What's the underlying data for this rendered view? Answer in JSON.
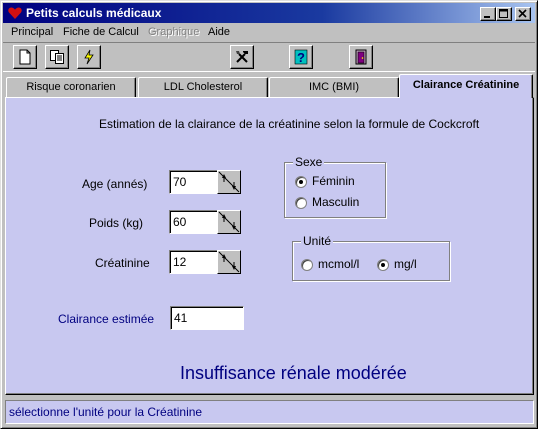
{
  "window": {
    "title": "Petits calculs médicaux"
  },
  "menu": [
    {
      "label": "Principal",
      "disabled": false
    },
    {
      "label": "Fiche de Calcul",
      "disabled": false
    },
    {
      "label": "Graphique",
      "disabled": true
    },
    {
      "label": "Aide",
      "disabled": false
    }
  ],
  "tabs": [
    {
      "label": "Risque coronarien"
    },
    {
      "label": "LDL Cholesterol"
    },
    {
      "label": "IMC (BMI)"
    },
    {
      "label": "Clairance Créatinine"
    }
  ],
  "form": {
    "heading": "Estimation de la clairance de la créatinine selon la formule de Cockcroft",
    "age": {
      "label": "Age (annés)",
      "value": "70"
    },
    "poids": {
      "label": "Poids (kg)",
      "value": "60"
    },
    "creatinine": {
      "label": "Créatinine",
      "value": "12"
    },
    "sexe": {
      "title": "Sexe",
      "options": [
        "Féminin",
        "Masculin"
      ],
      "selected": "Féminin"
    },
    "unite": {
      "title": "Unité",
      "options": [
        "mcmol/l",
        "mg/l"
      ],
      "selected": "mg/l"
    },
    "clairance": {
      "label": "Clairance estimée",
      "value": "41"
    },
    "diagnosis": "Insuffisance rénale modérée"
  },
  "status": "sélectionne l'unité pour la Créatinine",
  "colors": {
    "panel_background": "#c8c8f0",
    "title_start": "#000080",
    "result_text": "#000080"
  }
}
